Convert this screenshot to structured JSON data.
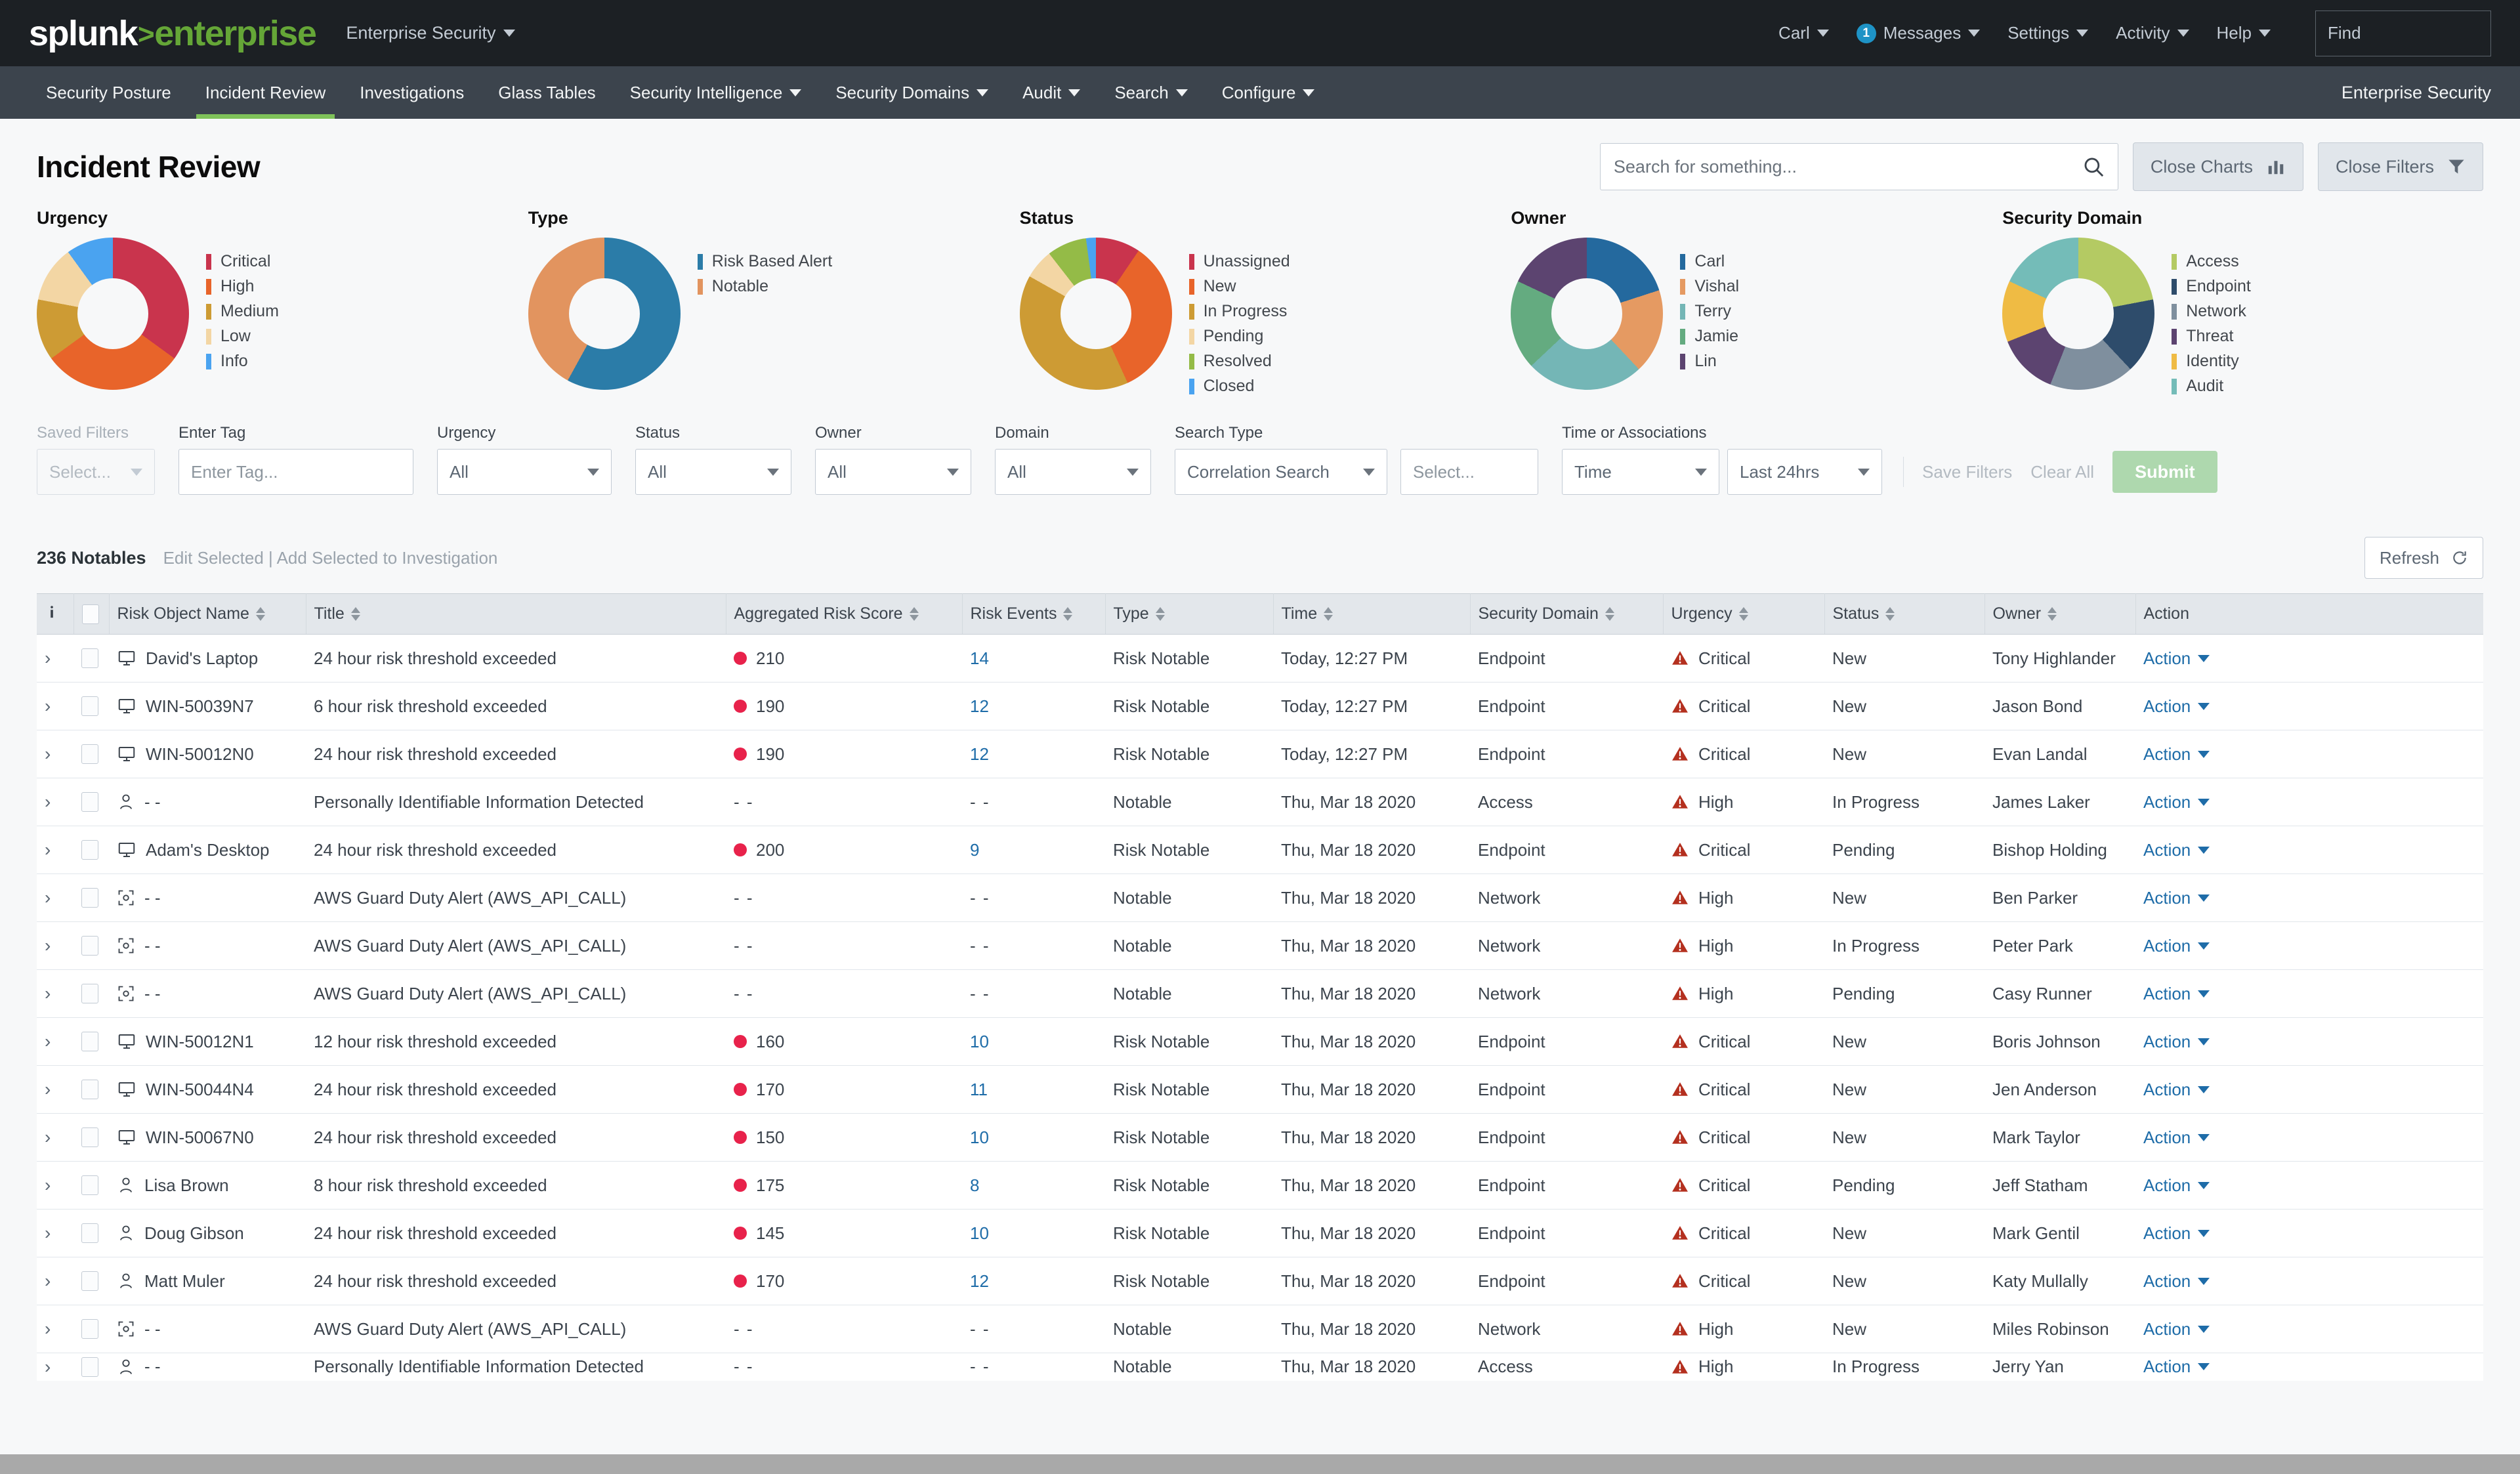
{
  "topbar": {
    "logo_splunk": "splunk",
    "logo_gt": ">",
    "logo_enterprise": "enterprise",
    "app_switcher": "Enterprise Security",
    "user": "Carl",
    "messages": "Messages",
    "messages_count": "1",
    "settings": "Settings",
    "activity": "Activity",
    "help": "Help",
    "find_placeholder": "Find"
  },
  "subnav": {
    "items": [
      {
        "label": "Security Posture",
        "has_caret": false,
        "active": false
      },
      {
        "label": "Incident Review",
        "has_caret": false,
        "active": true
      },
      {
        "label": "Investigations",
        "has_caret": false,
        "active": false
      },
      {
        "label": "Glass Tables",
        "has_caret": false,
        "active": false
      },
      {
        "label": "Security Intelligence",
        "has_caret": true,
        "active": false
      },
      {
        "label": "Security Domains",
        "has_caret": true,
        "active": false
      },
      {
        "label": "Audit",
        "has_caret": true,
        "active": false
      },
      {
        "label": "Search",
        "has_caret": true,
        "active": false
      },
      {
        "label": "Configure",
        "has_caret": true,
        "active": false
      }
    ],
    "right_label": "Enterprise Security"
  },
  "header": {
    "title": "Incident Review",
    "search_placeholder": "Search for something...",
    "close_charts": "Close Charts",
    "close_filters": "Close Filters"
  },
  "chart_data": [
    {
      "type": "pie",
      "title": "Urgency",
      "legend_position": "right",
      "categories": [
        "Critical",
        "High",
        "Medium",
        "Low",
        "Info"
      ],
      "values": [
        35,
        30,
        13,
        12,
        10
      ],
      "colors": [
        "#c9344d",
        "#e8642a",
        "#cd9b34",
        "#f3d6a4",
        "#4aa3f0"
      ]
    },
    {
      "type": "pie",
      "title": "Type",
      "legend_position": "right",
      "categories": [
        "Risk Based Alert",
        "Notable"
      ],
      "values": [
        58,
        42
      ],
      "colors": [
        "#2b7ca8",
        "#e2945f"
      ]
    },
    {
      "type": "pie",
      "title": "Status",
      "legend_position": "right",
      "categories": [
        "Unassigned",
        "New",
        "In Progress",
        "Pending",
        "Resolved",
        "Closed"
      ],
      "values": [
        9,
        32,
        38,
        6,
        8,
        2
      ],
      "colors": [
        "#c9344d",
        "#e8642a",
        "#cd9b34",
        "#f3d6a4",
        "#94bb47",
        "#4aa3f0"
      ]
    },
    {
      "type": "pie",
      "title": "Owner",
      "legend_position": "right",
      "categories": [
        "Carl",
        "Vishal",
        "Terry",
        "Jamie",
        "Lin"
      ],
      "values": [
        20,
        18,
        25,
        19,
        18
      ],
      "colors": [
        "#24699e",
        "#e59a62",
        "#74b6b6",
        "#64ab80",
        "#5c4470"
      ]
    },
    {
      "type": "pie",
      "title": "Security Domain",
      "legend_position": "right",
      "categories": [
        "Access",
        "Endpoint",
        "Network",
        "Threat",
        "Identity",
        "Audit"
      ],
      "values": [
        22,
        16,
        18,
        13,
        13,
        18
      ],
      "colors": [
        "#b4ca63",
        "#2e4c6b",
        "#7f8f9e",
        "#5c4470",
        "#efbb44",
        "#74bcb8"
      ]
    }
  ],
  "filters": {
    "saved_filters": {
      "label": "Saved Filters",
      "value": "Select...",
      "disabled": true
    },
    "enter_tag": {
      "label": "Enter Tag",
      "value": "Enter Tag..."
    },
    "urgency": {
      "label": "Urgency",
      "value": "All"
    },
    "status": {
      "label": "Status",
      "value": "All"
    },
    "owner": {
      "label": "Owner",
      "value": "All"
    },
    "domain": {
      "label": "Domain",
      "value": "All"
    },
    "search_type": {
      "label": "Search Type",
      "value": "Correlation Search",
      "secondary_value": "Select..."
    },
    "time": {
      "label": "Time or Associations",
      "value": "Time",
      "range_value": "Last 24hrs"
    },
    "save_filters": "Save Filters",
    "clear_all": "Clear All",
    "submit": "Submit"
  },
  "table": {
    "count_label": "236 Notables",
    "edit_selected": "Edit Selected",
    "separator": "|",
    "add_to_investigation": "Add Selected to Investigation",
    "refresh": "Refresh",
    "columns": [
      "Risk Object Name",
      "Title",
      "Aggregated Risk Score",
      "Risk Events",
      "Type",
      "Time",
      "Security Domain",
      "Urgency",
      "Status",
      "Owner",
      "Action"
    ],
    "action_label": "Action",
    "rows": [
      {
        "icon": "host",
        "object": "David's Laptop",
        "title": "24 hour risk threshold exceeded",
        "score": "210",
        "events": "14",
        "type": "Risk Notable",
        "time": "Today, 12:27 PM",
        "domain": "Endpoint",
        "urgency": "Critical",
        "status": "New",
        "owner": "Tony Highlander"
      },
      {
        "icon": "host",
        "object": "WIN-50039N7",
        "title": "6 hour risk threshold exceeded",
        "score": "190",
        "events": "12",
        "type": "Risk Notable",
        "time": "Today, 12:27 PM",
        "domain": "Endpoint",
        "urgency": "Critical",
        "status": "New",
        "owner": "Jason Bond"
      },
      {
        "icon": "host",
        "object": "WIN-50012N0",
        "title": "24 hour risk threshold exceeded",
        "score": "190",
        "events": "12",
        "type": "Risk Notable",
        "time": "Today, 12:27 PM",
        "domain": "Endpoint",
        "urgency": "Critical",
        "status": "New",
        "owner": "Evan Landal"
      },
      {
        "icon": "user",
        "object": "- -",
        "title": "Personally Identifiable Information Detected",
        "score": "- -",
        "events": "- -",
        "type": "Notable",
        "time": "Thu, Mar 18 2020",
        "domain": "Access",
        "urgency": "High",
        "status": "In Progress",
        "owner": "James Laker"
      },
      {
        "icon": "host",
        "object": "Adam's Desktop",
        "title": "24 hour risk threshold exceeded",
        "score": "200",
        "events": "9",
        "type": "Risk Notable",
        "time": "Thu, Mar 18 2020",
        "domain": "Endpoint",
        "urgency": "Critical",
        "status": "Pending",
        "owner": "Bishop Holding"
      },
      {
        "icon": "other",
        "object": "- -",
        "title": "AWS Guard Duty Alert (AWS_API_CALL)",
        "score": "- -",
        "events": "- -",
        "type": "Notable",
        "time": "Thu, Mar 18 2020",
        "domain": "Network",
        "urgency": "High",
        "status": "New",
        "owner": "Ben Parker"
      },
      {
        "icon": "other",
        "object": "- -",
        "title": "AWS Guard Duty Alert (AWS_API_CALL)",
        "score": "- -",
        "events": "- -",
        "type": "Notable",
        "time": "Thu, Mar 18 2020",
        "domain": "Network",
        "urgency": "High",
        "status": "In Progress",
        "owner": "Peter Park"
      },
      {
        "icon": "other",
        "object": "- -",
        "title": "AWS Guard Duty Alert (AWS_API_CALL)",
        "score": "- -",
        "events": "- -",
        "type": "Notable",
        "time": "Thu, Mar 18 2020",
        "domain": "Network",
        "urgency": "High",
        "status": "Pending",
        "owner": "Casy Runner"
      },
      {
        "icon": "host",
        "object": "WIN-50012N1",
        "title": "12 hour risk threshold exceeded",
        "score": "160",
        "events": "10",
        "type": "Risk Notable",
        "time": "Thu, Mar 18 2020",
        "domain": "Endpoint",
        "urgency": "Critical",
        "status": "New",
        "owner": "Boris Johnson"
      },
      {
        "icon": "host",
        "object": "WIN-50044N4",
        "title": "24 hour risk threshold exceeded",
        "score": "170",
        "events": "11",
        "type": "Risk Notable",
        "time": "Thu, Mar 18 2020",
        "domain": "Endpoint",
        "urgency": "Critical",
        "status": "New",
        "owner": "Jen Anderson"
      },
      {
        "icon": "host",
        "object": "WIN-50067N0",
        "title": "24 hour risk threshold exceeded",
        "score": "150",
        "events": "10",
        "type": "Risk Notable",
        "time": "Thu, Mar 18 2020",
        "domain": "Endpoint",
        "urgency": "Critical",
        "status": "New",
        "owner": "Mark Taylor"
      },
      {
        "icon": "user",
        "object": "Lisa Brown",
        "title": "8 hour risk threshold exceeded",
        "score": "175",
        "events": "8",
        "type": "Risk Notable",
        "time": "Thu, Mar 18 2020",
        "domain": "Endpoint",
        "urgency": "Critical",
        "status": "Pending",
        "owner": "Jeff Statham"
      },
      {
        "icon": "user",
        "object": "Doug Gibson",
        "title": "24 hour risk threshold exceeded",
        "score": "145",
        "events": "10",
        "type": "Risk Notable",
        "time": "Thu, Mar 18 2020",
        "domain": "Endpoint",
        "urgency": "Critical",
        "status": "New",
        "owner": "Mark Gentil"
      },
      {
        "icon": "user",
        "object": "Matt Muler",
        "title": "24 hour risk threshold exceeded",
        "score": "170",
        "events": "12",
        "type": "Risk Notable",
        "time": "Thu, Mar 18 2020",
        "domain": "Endpoint",
        "urgency": "Critical",
        "status": "New",
        "owner": "Katy Mullally"
      },
      {
        "icon": "other",
        "object": "- -",
        "title": "AWS Guard Duty Alert (AWS_API_CALL)",
        "score": "- -",
        "events": "- -",
        "type": "Notable",
        "time": "Thu, Mar 18 2020",
        "domain": "Network",
        "urgency": "High",
        "status": "New",
        "owner": "Miles Robinson"
      },
      {
        "icon": "user",
        "object": "- -",
        "title": "Personally Identifiable Information Detected",
        "score": "- -",
        "events": "- -",
        "type": "Notable",
        "time": "Thu, Mar 18 2020",
        "domain": "Access",
        "urgency": "High",
        "status": "In Progress",
        "owner": "Jerry Yan"
      }
    ]
  }
}
